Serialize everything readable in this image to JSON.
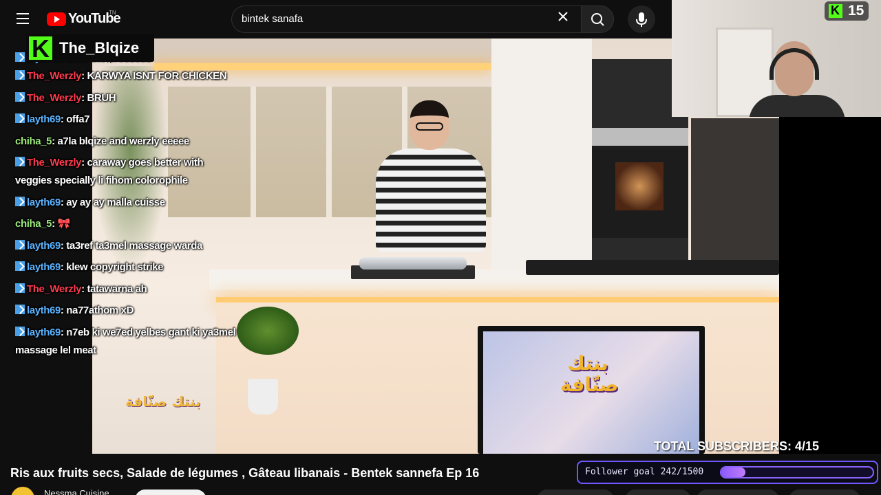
{
  "topbar": {
    "logo_text": "YouTube",
    "logo_superscript": "TN",
    "search_value": "bintek sanafa"
  },
  "streamer": {
    "name": "The_Blqize",
    "viewer_count": "15"
  },
  "chat": [
    {
      "user": "layth69",
      "msg": "trust the prossess",
      "color": "#5bb3ff",
      "badge": true,
      "cut": true
    },
    {
      "user": "The_Werzly",
      "msg": "KARWYA ISNT FOR CHICKEN",
      "color": "#ff3a4e",
      "badge": true
    },
    {
      "user": "The_Werzly",
      "msg": "BRUH",
      "color": "#ff3a4e",
      "badge": true
    },
    {
      "user": "layth69",
      "msg": "offa7",
      "color": "#5bb3ff",
      "badge": true
    },
    {
      "user": "chiha_5",
      "msg": "a7la blqize and werzly eeeee",
      "color": "#9dea7a",
      "badge": false
    },
    {
      "user": "The_Werzly",
      "msg": "caraway goes better with veggies specially li fihom colorophile",
      "color": "#ff3a4e",
      "badge": true
    },
    {
      "user": "layth69",
      "msg": "ay ay ay malla cuisse",
      "color": "#5bb3ff",
      "badge": true
    },
    {
      "user": "chiha_5",
      "msg": "",
      "color": "#9dea7a",
      "badge": false,
      "emote": "bow-emote"
    },
    {
      "user": "layth69",
      "msg": "ta3ref ta3mel massage warda",
      "color": "#5bb3ff",
      "badge": true
    },
    {
      "user": "layth69",
      "msg": "klew copyright strike",
      "color": "#5bb3ff",
      "badge": true
    },
    {
      "user": "The_Werzly",
      "msg": "tatawarna ah",
      "color": "#ff3a4e",
      "badge": true
    },
    {
      "user": "layth69",
      "msg": "na77athom xD",
      "color": "#5bb3ff",
      "badge": true
    },
    {
      "user": "layth69",
      "msg": "n7eb ki we7ed yelbes gant ki ya3mel massage lel meat",
      "color": "#5bb3ff",
      "badge": true
    }
  ],
  "video": {
    "title": "Ris aux fruits secs, Salade de légumes , Gâteau libanais - Bentek sannefa Ep 16",
    "show_logo_text": "بنتك صنّافة",
    "channel_name": "Nessma Cuisine"
  },
  "overlay": {
    "subscribers_text": "TOTAL SUBSCRIBERS: 4/15",
    "follower_goal_label": "Follower goal 242/1500",
    "follower_goal_current": 242,
    "follower_goal_target": 1500
  },
  "colors": {
    "kick_green": "#53fc18",
    "youtube_red": "#ff0000",
    "goal_purple": "#8c5bff"
  }
}
